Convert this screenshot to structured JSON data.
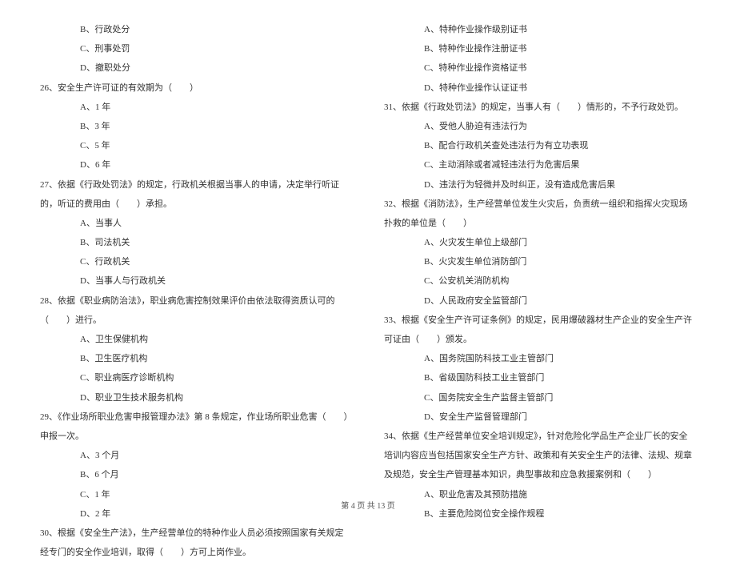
{
  "left": {
    "q25opts": {
      "b": "B、行政处分",
      "c": "C、刑事处罚",
      "d": "D、撤职处分"
    },
    "q26": {
      "stem": "26、安全生产许可证的有效期为（　　）",
      "a": "A、1 年",
      "b": "B、3 年",
      "c": "C、5 年",
      "d": "D、6 年"
    },
    "q27": {
      "stem": "27、依据《行政处罚法》的规定，行政机关根据当事人的申请，决定举行听证的，听证的费用由（　　）承担。",
      "a": "A、当事人",
      "b": "B、司法机关",
      "c": "C、行政机关",
      "d": "D、当事人与行政机关"
    },
    "q28": {
      "stem": "28、依据《职业病防治法》，职业病危害控制效果评价由依法取得资质认可的（　　）进行。",
      "a": "A、卫生保健机构",
      "b": "B、卫生医疗机构",
      "c": "C、职业病医疗诊断机构",
      "d": "D、职业卫生技术服务机构"
    },
    "q29": {
      "stem": "29、《作业场所职业危害申报管理办法》第 8 条规定，作业场所职业危害（　　）申报一次。",
      "a": "A、3 个月",
      "b": "B、6 个月",
      "c": "C、1 年",
      "d": "D、2 年"
    },
    "q30": {
      "stem": "30、根据《安全生产法》，生产经营单位的特种作业人员必须按照国家有关规定经专门的安全作业培训，取得（　　）方可上岗作业。"
    }
  },
  "right": {
    "q30opts": {
      "a": "A、特种作业操作级别证书",
      "b": "B、特种作业操作注册证书",
      "c": "C、特种作业操作资格证书",
      "d": "D、特种作业操作认证证书"
    },
    "q31": {
      "stem": "31、依据《行政处罚法》的规定，当事人有（　　）情形的，不予行政处罚。",
      "a": "A、受他人胁迫有违法行为",
      "b": "B、配合行政机关查处违法行为有立功表现",
      "c": "C、主动消除或者减轻违法行为危害后果",
      "d": "D、违法行为轻微并及时纠正，没有造成危害后果"
    },
    "q32": {
      "stem": "32、根据《消防法》，生产经营单位发生火灾后，负责统一组织和指挥火灾现场扑救的单位是（　　）",
      "a": "A、火灾发生单位上级部门",
      "b": "B、火灾发生单位消防部门",
      "c": "C、公安机关消防机构",
      "d": "D、人民政府安全监管部门"
    },
    "q33": {
      "stem": "33、根据《安全生产许可证条例》的规定，民用爆破器材生产企业的安全生产许可证由（　　）颁发。",
      "a": "A、国务院国防科技工业主管部门",
      "b": "B、省级国防科技工业主管部门",
      "c": "C、国务院安全生产监督主管部门",
      "d": "D、安全生产监督管理部门"
    },
    "q34": {
      "stem": "34、依据《生产经营单位安全培训规定》，针对危险化学品生产企业厂长的安全培训内容应当包括国家安全生产方针、政策和有关安全生产的法律、法规、规章及规范，安全生产管理基本知识，典型事故和应急救援案例和（　　）",
      "a": "A、职业危害及其预防措施",
      "b": "B、主要危险岗位安全操作规程"
    }
  },
  "footer": "第 4 页 共 13 页"
}
